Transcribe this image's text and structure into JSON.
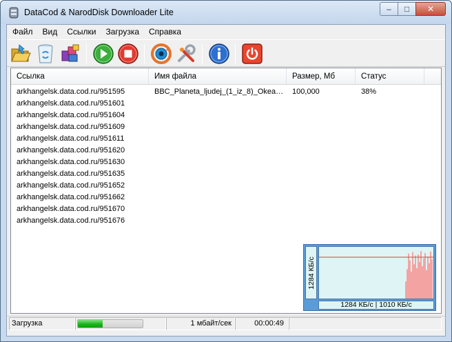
{
  "window": {
    "title": "DataCod & NarodDisk Downloader Lite",
    "caption_min": "–",
    "caption_max": "□",
    "caption_close": "✕"
  },
  "menu": [
    "Файл",
    "Вид",
    "Ссылки",
    "Загрузка",
    "Справка"
  ],
  "toolbar": {
    "buttons": [
      {
        "icon": "open-folder-icon"
      },
      {
        "icon": "recycle-bin-icon"
      },
      {
        "icon": "boxes-icon"
      },
      {
        "icon": "play-icon"
      },
      {
        "icon": "stop-icon"
      },
      {
        "icon": "refresh-icon"
      },
      {
        "icon": "settings-tools-icon"
      },
      {
        "icon": "info-icon"
      },
      {
        "icon": "power-exit-icon"
      }
    ]
  },
  "list": {
    "columns": [
      "Ссылка",
      "Имя файла",
      "Размер, Мб",
      "Статус"
    ],
    "rows": [
      {
        "link": "arkhangelsk.data.cod.ru/951595",
        "filename": "BBC_Planeta_ljudej_(1_iz_8)_Okeani....",
        "size": "100,000",
        "status": "38%"
      },
      {
        "link": "arkhangelsk.data.cod.ru/951601",
        "filename": "",
        "size": "",
        "status": ""
      },
      {
        "link": "arkhangelsk.data.cod.ru/951604",
        "filename": "",
        "size": "",
        "status": ""
      },
      {
        "link": "arkhangelsk.data.cod.ru/951609",
        "filename": "",
        "size": "",
        "status": ""
      },
      {
        "link": "arkhangelsk.data.cod.ru/951611",
        "filename": "",
        "size": "",
        "status": ""
      },
      {
        "link": "arkhangelsk.data.cod.ru/951620",
        "filename": "",
        "size": "",
        "status": ""
      },
      {
        "link": "arkhangelsk.data.cod.ru/951630",
        "filename": "",
        "size": "",
        "status": ""
      },
      {
        "link": "arkhangelsk.data.cod.ru/951635",
        "filename": "",
        "size": "",
        "status": ""
      },
      {
        "link": "arkhangelsk.data.cod.ru/951652",
        "filename": "",
        "size": "",
        "status": ""
      },
      {
        "link": "arkhangelsk.data.cod.ru/951662",
        "filename": "",
        "size": "",
        "status": ""
      },
      {
        "link": "arkhangelsk.data.cod.ru/951670",
        "filename": "",
        "size": "",
        "status": ""
      },
      {
        "link": "arkhangelsk.data.cod.ru/951676",
        "filename": "",
        "size": "",
        "status": ""
      }
    ]
  },
  "speed_graph": {
    "axis_label": "1284 КБ/с",
    "legend": "1284 КБ/с  |  1010 КБ/с",
    "line_color": "#d94040",
    "bar_color": "#f4a3a3",
    "bars": [
      0.35,
      0.6,
      0.92,
      0.78,
      0.55,
      0.95,
      0.7,
      0.88,
      0.62,
      0.9,
      0.75,
      0.97,
      0.66,
      0.82,
      0.93,
      0.58,
      0.86,
      0.72,
      0.96,
      0.8
    ]
  },
  "status": {
    "label": "Загрузка",
    "progress": 0.38,
    "speed": "1 мбайт/сек",
    "time": "00:00:49"
  }
}
